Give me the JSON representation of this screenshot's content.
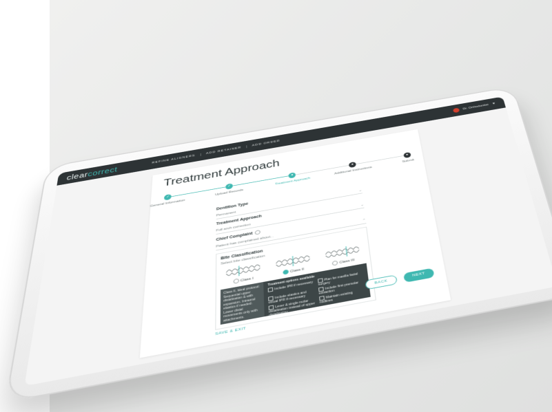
{
  "topbar": {
    "brand_prefix": "clear",
    "brand_accent": "correct",
    "nav": [
      "REFINE ALIGNERS",
      "ADD RETAINER",
      "ADD ORDER"
    ],
    "user_name": "Dr. Orthodontist"
  },
  "page": {
    "title": "Treatment Approach"
  },
  "steps": [
    {
      "label": "General Information",
      "state": "done"
    },
    {
      "label": "Upload Records",
      "state": "done"
    },
    {
      "label": "Treatment Approach",
      "state": "active"
    },
    {
      "label": "Additional Instructions",
      "state": "pending"
    },
    {
      "label": "Submit",
      "state": "pending"
    }
  ],
  "form": {
    "dentition_label": "Dentition Type",
    "dentition_value": "Permanent",
    "approach_label": "Treatment Approach",
    "approach_value": "Full arch correction",
    "complaint_label": "Chief Complaint",
    "complaint_value": "Patient has complained about...",
    "bite_label": "Bite Classification",
    "bite_sub": "Select bite classification",
    "classes": [
      {
        "label": "Class I",
        "selected": false
      },
      {
        "label": "Class II",
        "selected": true
      },
      {
        "label": "Class III",
        "selected": false
      }
    ],
    "panel_left": "Class II, Ideal protocol: Sequential upper distalization & with expansion. Intraoral elastics if needed. Lower distal movements only with attachments.",
    "panel_title": "Treatment options available",
    "options": [
      "Include IPR if necessary",
      "Plan for maxilla facial surgery",
      "Include elastics and virtual IPR if necessary",
      "Include first premolar extraction",
      "Lever & single molar distalization instead of upper distalization",
      "Maintain existing midlines"
    ]
  },
  "buttons": {
    "back": "BACK",
    "next": "NEXT",
    "save_exit": "SAVE & EXIT"
  },
  "colors": {
    "accent": "#3fb8b1",
    "topbar": "#2d3335"
  }
}
